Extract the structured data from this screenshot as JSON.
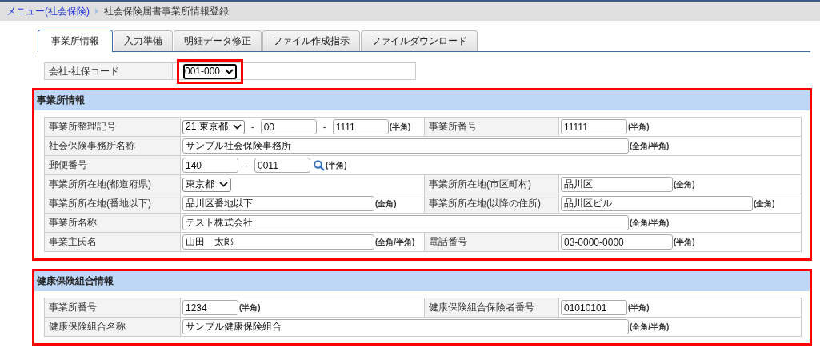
{
  "breadcrumb": {
    "link": "メニュー(社会保険)",
    "title": "社会保険届書事業所情報登録"
  },
  "tabs": [
    {
      "label": "事業所情報",
      "selected": true
    },
    {
      "label": "入力準備",
      "selected": false
    },
    {
      "label": "明細データ修正",
      "selected": false
    },
    {
      "label": "ファイル作成指示",
      "selected": false
    },
    {
      "label": "ファイルダウンロード",
      "selected": false
    }
  ],
  "company_code": {
    "label": "会社-社保コード",
    "value": "001-000",
    "highlighted": true
  },
  "sections": [
    {
      "title": "事業所情報",
      "highlighted": true,
      "rows": [
        [
          {
            "label": "事業所整理記号",
            "items": [
              {
                "kind": "select",
                "value": "21 東京都"
              },
              {
                "kind": "sep",
                "text": "-"
              },
              {
                "kind": "input-xs",
                "value": "00"
              },
              {
                "kind": "sep",
                "text": "-"
              },
              {
                "kind": "input-xs",
                "value": "1111"
              },
              {
                "kind": "hint",
                "text": "(半角)"
              }
            ]
          },
          {
            "label": "事業所番号",
            "items": [
              {
                "kind": "input-s",
                "value": "11111"
              },
              {
                "kind": "hint",
                "text": "(半角)"
              }
            ]
          }
        ],
        [
          {
            "label": "社会保険事務所名称",
            "items": [
              {
                "kind": "input-full",
                "value": "サンプル社会保険事務所"
              },
              {
                "kind": "hint",
                "text": "(全角/半角)"
              }
            ]
          }
        ],
        [
          {
            "label": "郵便番号",
            "items": [
              {
                "kind": "input-xs",
                "value": "140"
              },
              {
                "kind": "sep",
                "text": "-"
              },
              {
                "kind": "input-xs",
                "value": "0011"
              },
              {
                "kind": "search"
              },
              {
                "kind": "hint",
                "text": "(半角)"
              }
            ]
          }
        ],
        [
          {
            "label": "事業所所在地(都道府県)",
            "items": [
              {
                "kind": "select",
                "value": "東京都"
              }
            ]
          },
          {
            "label": "事業所所在地(市区町村)",
            "items": [
              {
                "kind": "input-m",
                "value": "品川区"
              },
              {
                "kind": "hint",
                "text": "(全角)"
              }
            ]
          }
        ],
        [
          {
            "label": "事業所所在地(番地以下)",
            "items": [
              {
                "kind": "input-l",
                "value": "品川区番地以下"
              },
              {
                "kind": "hint",
                "text": "(全角)"
              }
            ]
          },
          {
            "label": "事業所所在地(以降の住所)",
            "items": [
              {
                "kind": "input-l",
                "value": "品川区ビル"
              },
              {
                "kind": "hint",
                "text": "(全角)"
              }
            ]
          }
        ],
        [
          {
            "label": "事業所名称",
            "items": [
              {
                "kind": "input-full",
                "value": "テスト株式会社"
              },
              {
                "kind": "hint",
                "text": "(全角/半角)"
              }
            ]
          }
        ],
        [
          {
            "label": "事業主氏名",
            "items": [
              {
                "kind": "input-l",
                "value": "山田　太郎"
              },
              {
                "kind": "hint",
                "text": "(全角/半角)"
              }
            ]
          },
          {
            "label": "電話番号",
            "items": [
              {
                "kind": "input-m",
                "value": "03-0000-0000"
              },
              {
                "kind": "hint",
                "text": "(半角)"
              }
            ]
          }
        ]
      ]
    },
    {
      "title": "健康保険組合情報",
      "highlighted": true,
      "rows": [
        [
          {
            "label": "事業所番号",
            "items": [
              {
                "kind": "input-xs",
                "value": "1234"
              },
              {
                "kind": "hint",
                "text": "(半角)"
              }
            ]
          },
          {
            "label": "健康保険組合保険者番号",
            "items": [
              {
                "kind": "input-s",
                "value": "01010101"
              },
              {
                "kind": "hint",
                "text": "(半角)"
              }
            ]
          }
        ],
        [
          {
            "label": "健康保険組合名称",
            "items": [
              {
                "kind": "input-full",
                "value": "サンプル健康保険組合"
              },
              {
                "kind": "hint",
                "text": "(全角/半角)"
              }
            ]
          }
        ]
      ]
    }
  ]
}
